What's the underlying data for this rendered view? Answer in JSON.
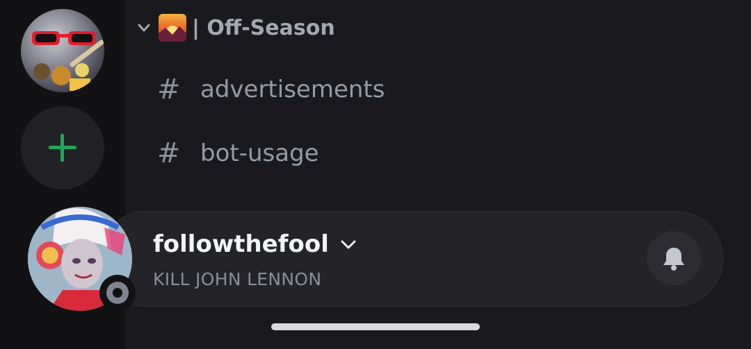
{
  "server_list": {
    "servers": [
      {
        "icon": "server-avatar"
      }
    ],
    "add_server": {
      "icon": "plus-icon",
      "color": "#23a55a"
    }
  },
  "channel_list": {
    "category": {
      "emoji": "sunrise-emoji",
      "name": "| Off-Season",
      "expanded": true
    },
    "channels": [
      {
        "type": "text",
        "icon": "#",
        "name": "advertisements"
      },
      {
        "type": "text",
        "icon": "#",
        "name": "bot-usage"
      }
    ]
  },
  "user_panel": {
    "username": "followthefool",
    "custom_status": "KILL JOHN LENNON",
    "presence": "offline",
    "notifications_icon": "bell-icon"
  },
  "colors": {
    "background": "#121214",
    "panel": "#1a1a1e",
    "user_bar": "#232328",
    "accent_green": "#23a55a"
  }
}
